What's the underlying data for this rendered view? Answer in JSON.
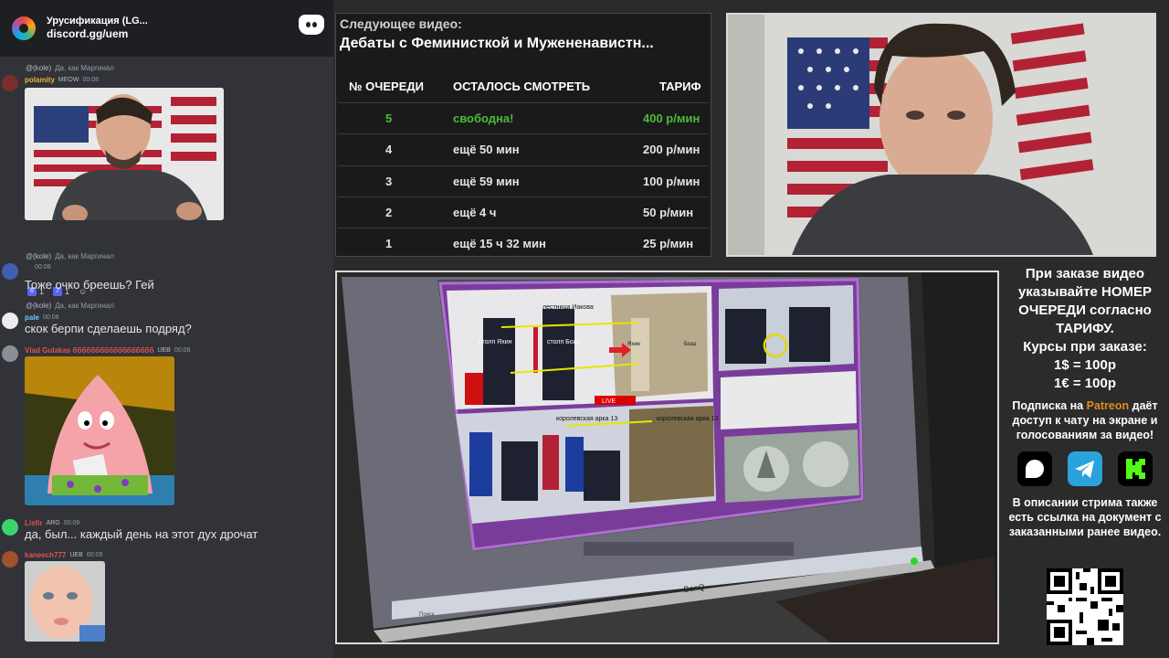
{
  "chat": {
    "server_name": "Урусификация (LG...",
    "server_link": "discord.gg/uem",
    "messages": [
      {
        "reply_name": "@(kole)",
        "reply_text": "Да, как Маргинал",
        "username": "polamity",
        "user_color": "#e8b23a",
        "badge": "MEOW",
        "time": "00:08",
        "has_image": true,
        "reactions": [
          {
            "emoji": "6",
            "count": "1"
          },
          {
            "emoji": "7",
            "count": "1"
          }
        ]
      },
      {
        "reply_name": "@(kole)",
        "reply_text": "Да, как Маргинал",
        "username": "",
        "user_color": "#bbbbbb",
        "badge": "",
        "time": "00:08",
        "text": "Тоже очко бреешь? Гей"
      },
      {
        "reply_name": "@(kole)",
        "reply_text": "Да, как Маргинал",
        "username": "pale",
        "user_color": "#6ec6ff",
        "badge": "",
        "time": "00:08",
        "text": "скок берпи сделаешь подряд?"
      },
      {
        "username": "Vlad Gulakas бббббббббббббббббб",
        "user_color": "#e05252",
        "badge": "UEB",
        "time": "00:08",
        "has_image": true
      },
      {
        "username": "Lisfir",
        "user_color": "#e05252",
        "badge": "ARG",
        "time": "00:09",
        "text": "да, был... каждый день на этот дух дрочат"
      },
      {
        "username": "kaneech777",
        "user_color": "#e05252",
        "badge": "UEB",
        "time": "00:09",
        "has_image": true
      }
    ]
  },
  "queue": {
    "label": "Следующее видео:",
    "title": "Дебаты с Феминисткой и Мужененавистн...",
    "headers": [
      "№ ОЧЕРЕДИ",
      "ОСТАЛОСЬ СМОТРЕТЬ",
      "ТАРИФ"
    ],
    "rows": [
      {
        "num": "5",
        "remaining": "свободна!",
        "tariff": "400 р/мин",
        "free": true
      },
      {
        "num": "4",
        "remaining": "ещё 50 мин",
        "tariff": "200 р/мин",
        "free": false
      },
      {
        "num": "3",
        "remaining": "ещё 59 мин",
        "tariff": "100 р/мин",
        "free": false
      },
      {
        "num": "2",
        "remaining": "ещё 4 ч",
        "tariff": "50 р/мин",
        "free": false
      },
      {
        "num": "1",
        "remaining": "ещё 15 ч 32 мин",
        "tariff": "25 р/мин",
        "free": false
      }
    ]
  },
  "screen_photo": {
    "slide_labels": [
      "лестница Иакова",
      "столп Яхин",
      "столп Боаз",
      "Яхин",
      "Боаз",
      "королевская арка 13",
      "королевская арка 13"
    ],
    "live_badge": "LIVE",
    "monitor_brand": "BenQ",
    "taskbar_search": "Поиск"
  },
  "info": {
    "main": "При заказе видео указывайте НОМЕР ОЧЕРЕДИ согласно ТАРИФУ.",
    "rates_title": "Курсы при заказе:",
    "rate_usd": "1$ = 100р",
    "rate_eur": "1€ = 100р",
    "sub_prefix": "Подписка на ",
    "sub_brand": "Patreon",
    "sub_suffix": "даёт доступ к чату на экране и голосованиям за видео!",
    "description": "В описании стрима также есть ссылка на документ с заказанными ранее видео.",
    "colors": {
      "patreon": "#e08a1e",
      "telegram": "#2aa3dd",
      "free_green": "#4cbb3a"
    }
  }
}
